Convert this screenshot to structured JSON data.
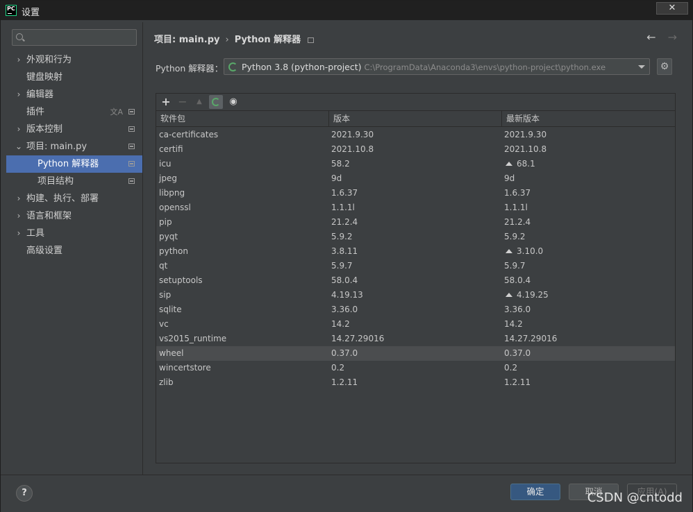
{
  "window": {
    "title": "设置",
    "close_glyph": "✕",
    "app_icon_text": "PC"
  },
  "sidebar": {
    "search_placeholder": "",
    "items": [
      {
        "label": "外观和行为",
        "chevron": "›"
      },
      {
        "label": "键盘映射"
      },
      {
        "label": "编辑器",
        "chevron": "›"
      },
      {
        "label": "插件"
      },
      {
        "label": "版本控制",
        "chevron": "›"
      },
      {
        "label": "项目: main.py",
        "chevron": "⌄"
      },
      {
        "label": "Python 解释器"
      },
      {
        "label": "项目结构"
      },
      {
        "label": "构建、执行、部署",
        "chevron": "›"
      },
      {
        "label": "语言和框架",
        "chevron": "›"
      },
      {
        "label": "工具",
        "chevron": "›"
      },
      {
        "label": "高级设置"
      }
    ]
  },
  "breadcrumb": {
    "project": "项目: main.py",
    "separator": "›",
    "page": "Python 解释器"
  },
  "nav": {
    "back": "←",
    "forward": "→"
  },
  "interpreter": {
    "label": "Python 解释器：",
    "name": "Python 3.8 (python-project)",
    "path": "C:\\ProgramData\\Anaconda3\\envs\\python-project\\python.exe",
    "gear": "⚙"
  },
  "toolbar": {
    "add": "+",
    "remove": "−",
    "up": "▲",
    "eye": "◉"
  },
  "table": {
    "headers": [
      "软件包",
      "版本",
      "最新版本"
    ],
    "rows": [
      {
        "pkg": "ca-certificates",
        "ver": "2021.9.30",
        "latest": "2021.9.30"
      },
      {
        "pkg": "certifi",
        "ver": "2021.10.8",
        "latest": "2021.10.8"
      },
      {
        "pkg": "icu",
        "ver": "58.2",
        "latest": "68.1"
      },
      {
        "pkg": "jpeg",
        "ver": "9d",
        "latest": "9d"
      },
      {
        "pkg": "libpng",
        "ver": "1.6.37",
        "latest": "1.6.37"
      },
      {
        "pkg": "openssl",
        "ver": "1.1.1l",
        "latest": "1.1.1l"
      },
      {
        "pkg": "pip",
        "ver": "21.2.4",
        "latest": "21.2.4"
      },
      {
        "pkg": "pyqt",
        "ver": "5.9.2",
        "latest": "5.9.2"
      },
      {
        "pkg": "python",
        "ver": "3.8.11",
        "latest": "3.10.0"
      },
      {
        "pkg": "qt",
        "ver": "5.9.7",
        "latest": "5.9.7"
      },
      {
        "pkg": "setuptools",
        "ver": "58.0.4",
        "latest": "58.0.4"
      },
      {
        "pkg": "sip",
        "ver": "4.19.13",
        "latest": "4.19.25"
      },
      {
        "pkg": "sqlite",
        "ver": "3.36.0",
        "latest": "3.36.0"
      },
      {
        "pkg": "vc",
        "ver": "14.2",
        "latest": "14.2"
      },
      {
        "pkg": "vs2015_runtime",
        "ver": "14.27.29016",
        "latest": "14.27.29016"
      },
      {
        "pkg": "wheel",
        "ver": "0.37.0",
        "latest": "0.37.0"
      },
      {
        "pkg": "wincertstore",
        "ver": "0.2",
        "latest": "0.2"
      },
      {
        "pkg": "zlib",
        "ver": "1.2.11",
        "latest": "1.2.11"
      }
    ]
  },
  "footer": {
    "help": "?",
    "ok": "确定",
    "cancel": "取消",
    "apply": "应用(A)"
  },
  "watermark": "CSDN @cntodd",
  "colors": {
    "selection": "#4b6eaf",
    "ok_button": "#365880",
    "spinner": "#59a869"
  }
}
